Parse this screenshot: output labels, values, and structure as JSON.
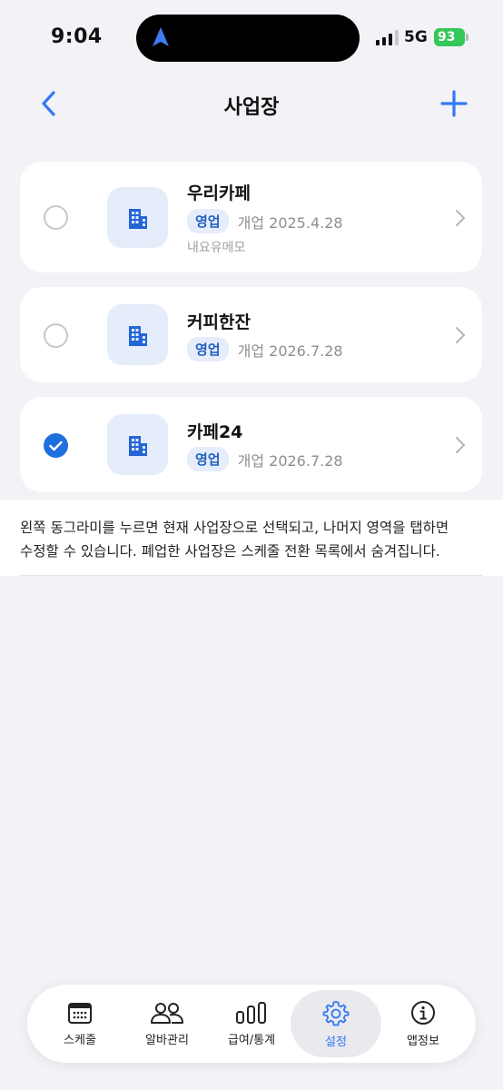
{
  "status": {
    "time": "9:04",
    "network": "5G",
    "battery": "93"
  },
  "header": {
    "title": "사업장"
  },
  "workplaces": [
    {
      "name": "우리카페",
      "status": "영업",
      "opened": "개업 2025.4.28",
      "memo": "내요유메모",
      "selected": false
    },
    {
      "name": "커피한잔",
      "status": "영업",
      "opened": "개업 2026.7.28",
      "selected": false
    },
    {
      "name": "카페24",
      "status": "영업",
      "opened": "개업 2026.7.28",
      "selected": true
    }
  ],
  "notice": {
    "line1": "왼쪽 동그라미를 누르면 현재 사업장으로 선택되고, 나머지 영역을 탭하면",
    "line2": "수정할 수 있습니다. 폐업한 사업장은 스케줄 전환 목록에서 숨겨집니다."
  },
  "tabbar": {
    "active": "settings",
    "items": [
      {
        "key": "schedule",
        "label": "스케줄",
        "icon": "calendar-icon"
      },
      {
        "key": "staff",
        "label": "알바관리",
        "icon": "people-icon"
      },
      {
        "key": "payroll",
        "label": "급여/통계",
        "icon": "bar-chart-icon"
      },
      {
        "key": "settings",
        "label": "설정",
        "icon": "gear-icon"
      },
      {
        "key": "appinfo",
        "label": "앱정보",
        "icon": "info-icon"
      }
    ]
  },
  "colors": {
    "accent": "#1f6fde",
    "badge_bg": "#e5edfb",
    "background": "#f2f2f7",
    "battery": "#34c759"
  }
}
